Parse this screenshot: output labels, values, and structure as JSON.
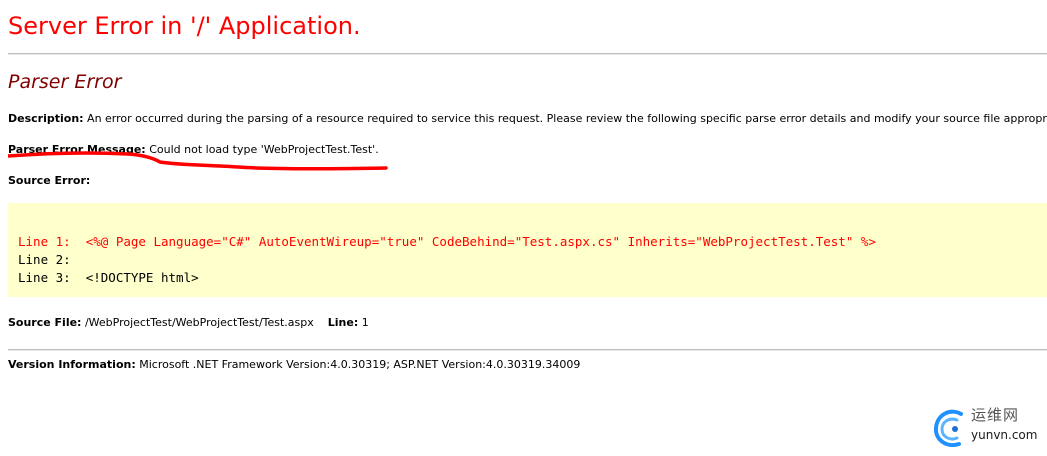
{
  "page_title": "Server Error in '/' Application.",
  "error_type": "Parser Error",
  "description": {
    "label": "Description:",
    "text": "An error occurred during the parsing of a resource required to service this request. Please review the following specific parse error details and modify your source file appropriately."
  },
  "parser_error_message": {
    "label": "Parser Error Message:",
    "text": "Could not load type 'WebProjectTest.Test'."
  },
  "source_error": {
    "label": "Source Error:",
    "lines": [
      {
        "text": "Line 1:  <%@ Page Language=\"C#\" AutoEventWireup=\"true\" CodeBehind=\"Test.aspx.cs\" Inherits=\"WebProjectTest.Test\" %>",
        "is_error": true
      },
      {
        "text": "Line 2:",
        "is_error": false
      },
      {
        "text": "Line 3:  <!DOCTYPE html>",
        "is_error": false
      }
    ]
  },
  "source_file": {
    "label": "Source File:",
    "path": "/WebProjectTest/WebProjectTest/Test.aspx",
    "line_label": "Line:",
    "line_value": "1"
  },
  "version_info": {
    "label": "Version Information:",
    "text": "Microsoft .NET Framework Version:4.0.30319; ASP.NET Version:4.0.30319.34009"
  },
  "watermark": {
    "cn": "运维网",
    "en": "yunvn.com"
  },
  "colors": {
    "title": "#ff0000",
    "subtitle": "#800000",
    "code_background": "#ffffcc",
    "error_line": "#ff0000",
    "annotation": "#ff0000"
  },
  "icons": {
    "watermark_logo": "swirl-logo-icon"
  }
}
